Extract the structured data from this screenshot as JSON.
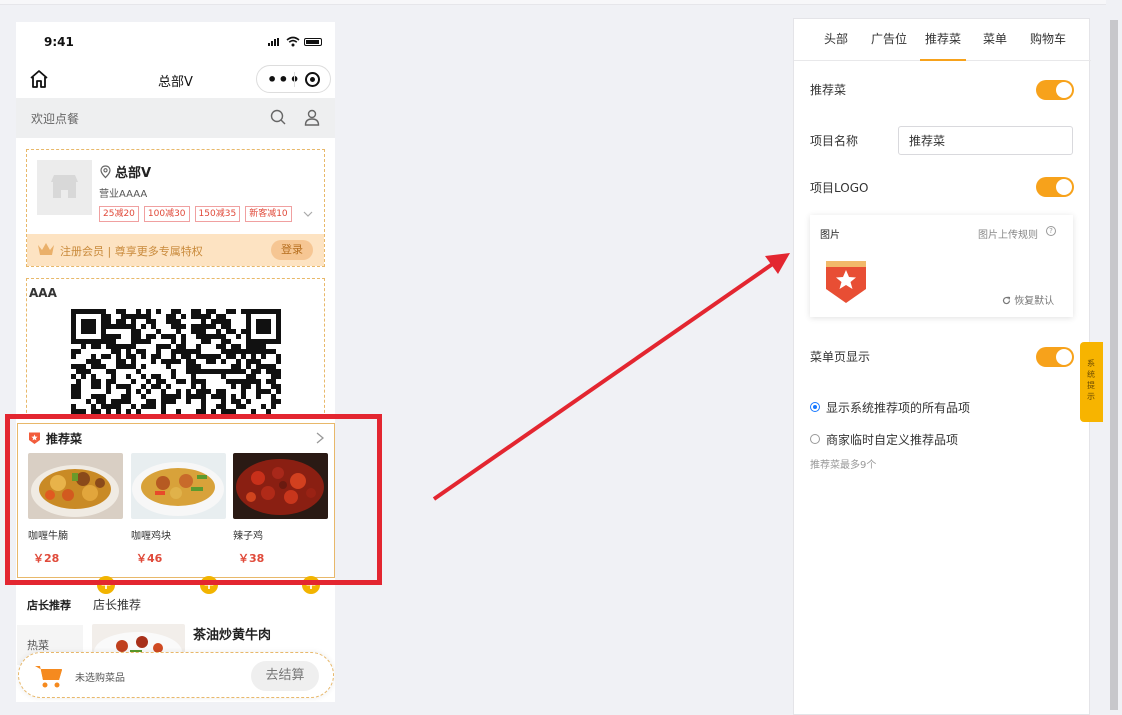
{
  "phone": {
    "status_time": "9:41",
    "nav_title": "总部V",
    "search": {
      "welcome": "欢迎点餐"
    },
    "store": {
      "name": "总部V",
      "status": "营业AAAA",
      "tags": [
        "25减20",
        "100减30",
        "150减35",
        "新客减10"
      ],
      "member_text": "注册会员 | 尊享更多专属特权",
      "login_label": "登录"
    },
    "qr_block": {
      "title": "AAA"
    },
    "recommend": {
      "title": "推荐菜",
      "dishes": [
        {
          "name": "咖喱牛腩",
          "price": "￥28"
        },
        {
          "name": "咖喱鸡块",
          "price": "￥46"
        },
        {
          "name": "辣子鸡",
          "price": "￥38"
        }
      ]
    },
    "shop_recommend": {
      "title_bold": "店长推荐",
      "title_normal": "店长推荐",
      "category": "热菜",
      "product_name": "茶油炒黄牛肉"
    },
    "cart": {
      "empty_text": "未选购菜品",
      "checkout_label": "去结算"
    }
  },
  "panel": {
    "tabs": [
      "头部",
      "广告位",
      "推荐菜",
      "菜单",
      "购物车"
    ],
    "active_tab": "推荐菜",
    "recommend_label": "推荐菜",
    "recommend_enabled": true,
    "item_name_label": "项目名称",
    "item_name_value": "推荐菜",
    "logo_label": "项目LOGO",
    "logo_enabled": true,
    "image_label": "图片",
    "upload_rule": "图片上传规则",
    "restore_label": "恢复默认",
    "menu_show_label": "菜单页显示",
    "menu_show_enabled": true,
    "option_all": "显示系统推荐项的所有品项",
    "option_custom": "商家临时自定义推荐品项",
    "selected_option": "option_all",
    "hint": "推荐菜最多9个"
  },
  "system_tip": "系统提示",
  "colors": {
    "accent": "#f7a21b",
    "highlight": "#e32630",
    "price": "#e04a3a",
    "radio": "#1677ff"
  }
}
